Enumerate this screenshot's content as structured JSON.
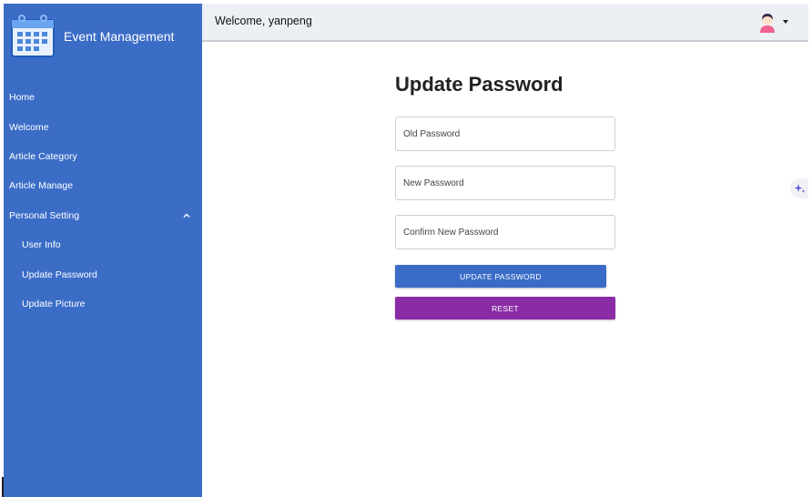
{
  "brand": {
    "title": "Event Management",
    "logo_icon": "calendar-icon"
  },
  "sidebar": {
    "items": [
      {
        "label": "Home"
      },
      {
        "label": "Welcome"
      },
      {
        "label": "Article Category"
      },
      {
        "label": "Article Manage"
      },
      {
        "label": "Personal Setting",
        "expanded": true
      },
      {
        "label": "User Info"
      },
      {
        "label": "Update Password"
      },
      {
        "label": "Update Picture"
      }
    ]
  },
  "header": {
    "welcome": "Welcome, yanpeng",
    "avatar_icon": "user-avatar-icon"
  },
  "main": {
    "title": "Update Password",
    "fields": [
      {
        "placeholder": "Old Password",
        "value": ""
      },
      {
        "placeholder": "New Password",
        "value": ""
      },
      {
        "placeholder": "Confirm New Password",
        "value": ""
      }
    ],
    "buttons": {
      "update": "UPDATE PASSWORD",
      "reset": "RESET"
    }
  },
  "colors": {
    "sidebar_bg": "#3b6dc7",
    "update_button": "#3a6cc7",
    "reset_button": "#8a2ca6",
    "topbar_bg": "#eceff3"
  }
}
